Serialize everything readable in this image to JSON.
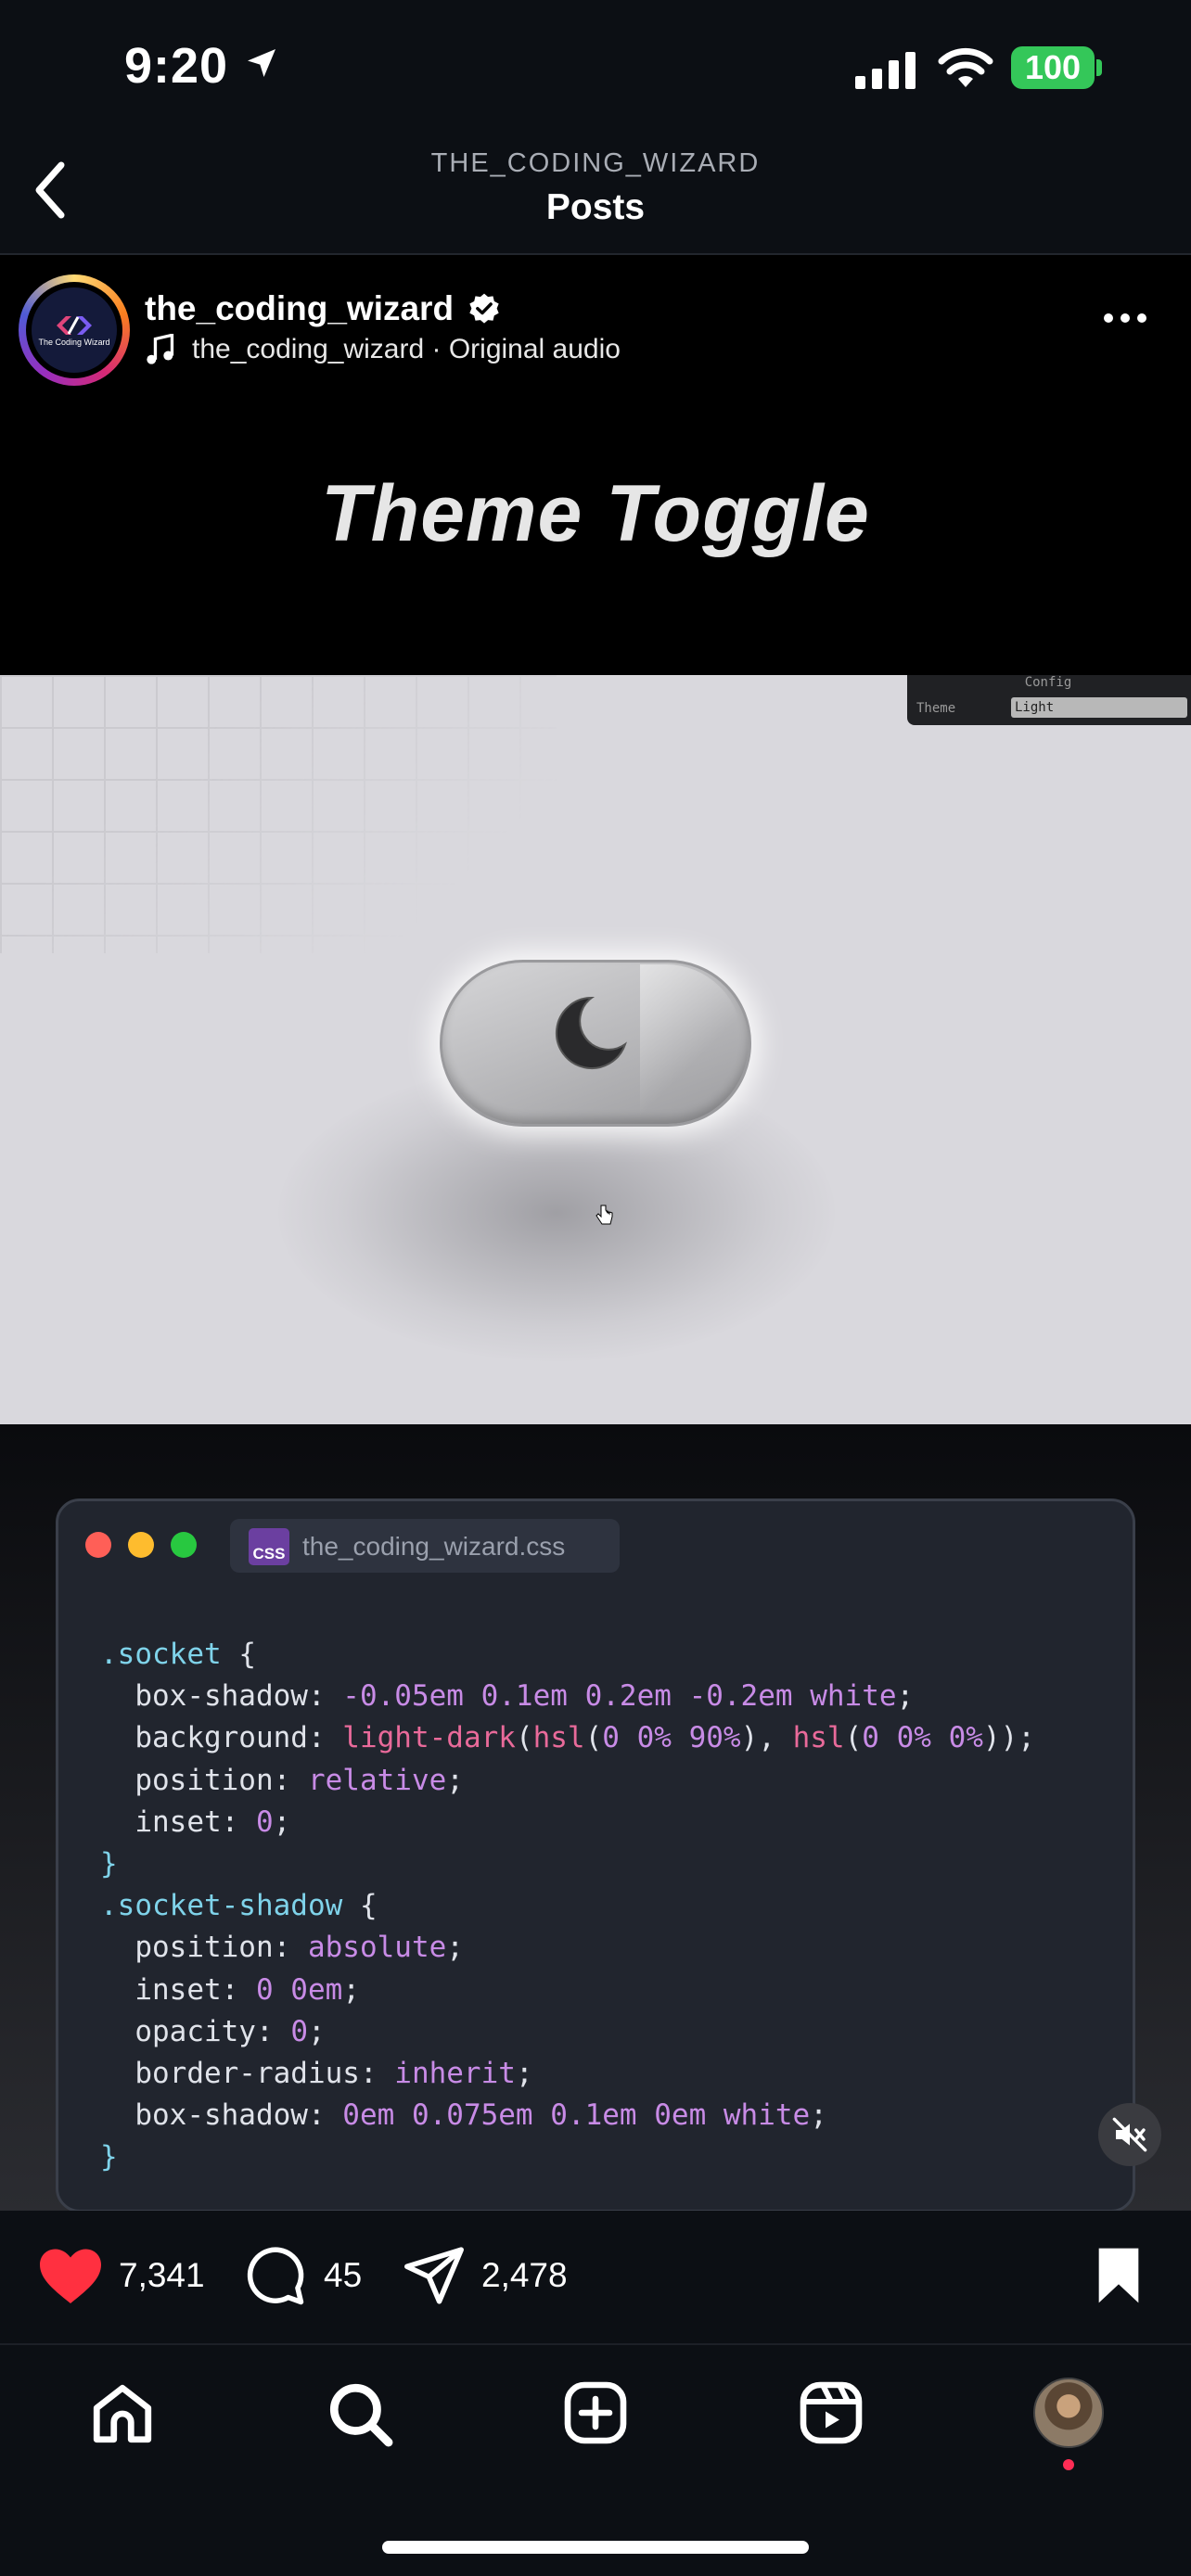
{
  "status_bar": {
    "time": "9:20",
    "battery": "100"
  },
  "header": {
    "username": "THE_CODING_WIZARD",
    "title": "Posts"
  },
  "post": {
    "username": "the_coding_wizard",
    "audio": "the_coding_wizard · Original audio",
    "avatar_text": "The Coding Wizard",
    "video_title": "Theme Toggle"
  },
  "demo": {
    "config_title": "Config",
    "config_label": "Theme",
    "config_value": "Light"
  },
  "code_window": {
    "filename": "the_coding_wizard.css",
    "badge": "CSS"
  },
  "actions": {
    "likes": "7,341",
    "comments": "45",
    "shares": "2,478"
  },
  "colors": {
    "accent_like": "#ff3040",
    "battery": "#34c759",
    "css_badge": "#6b3fa0"
  },
  "icons": [
    "back-chevron-icon",
    "location-arrow-icon",
    "signal-icon",
    "wifi-icon",
    "verified-icon",
    "music-note-icon",
    "more-icon",
    "moon-icon",
    "cursor-icon",
    "mute-icon",
    "heart-icon",
    "comment-icon",
    "share-icon",
    "bookmark-icon",
    "home-icon",
    "search-icon",
    "create-icon",
    "reels-icon"
  ]
}
